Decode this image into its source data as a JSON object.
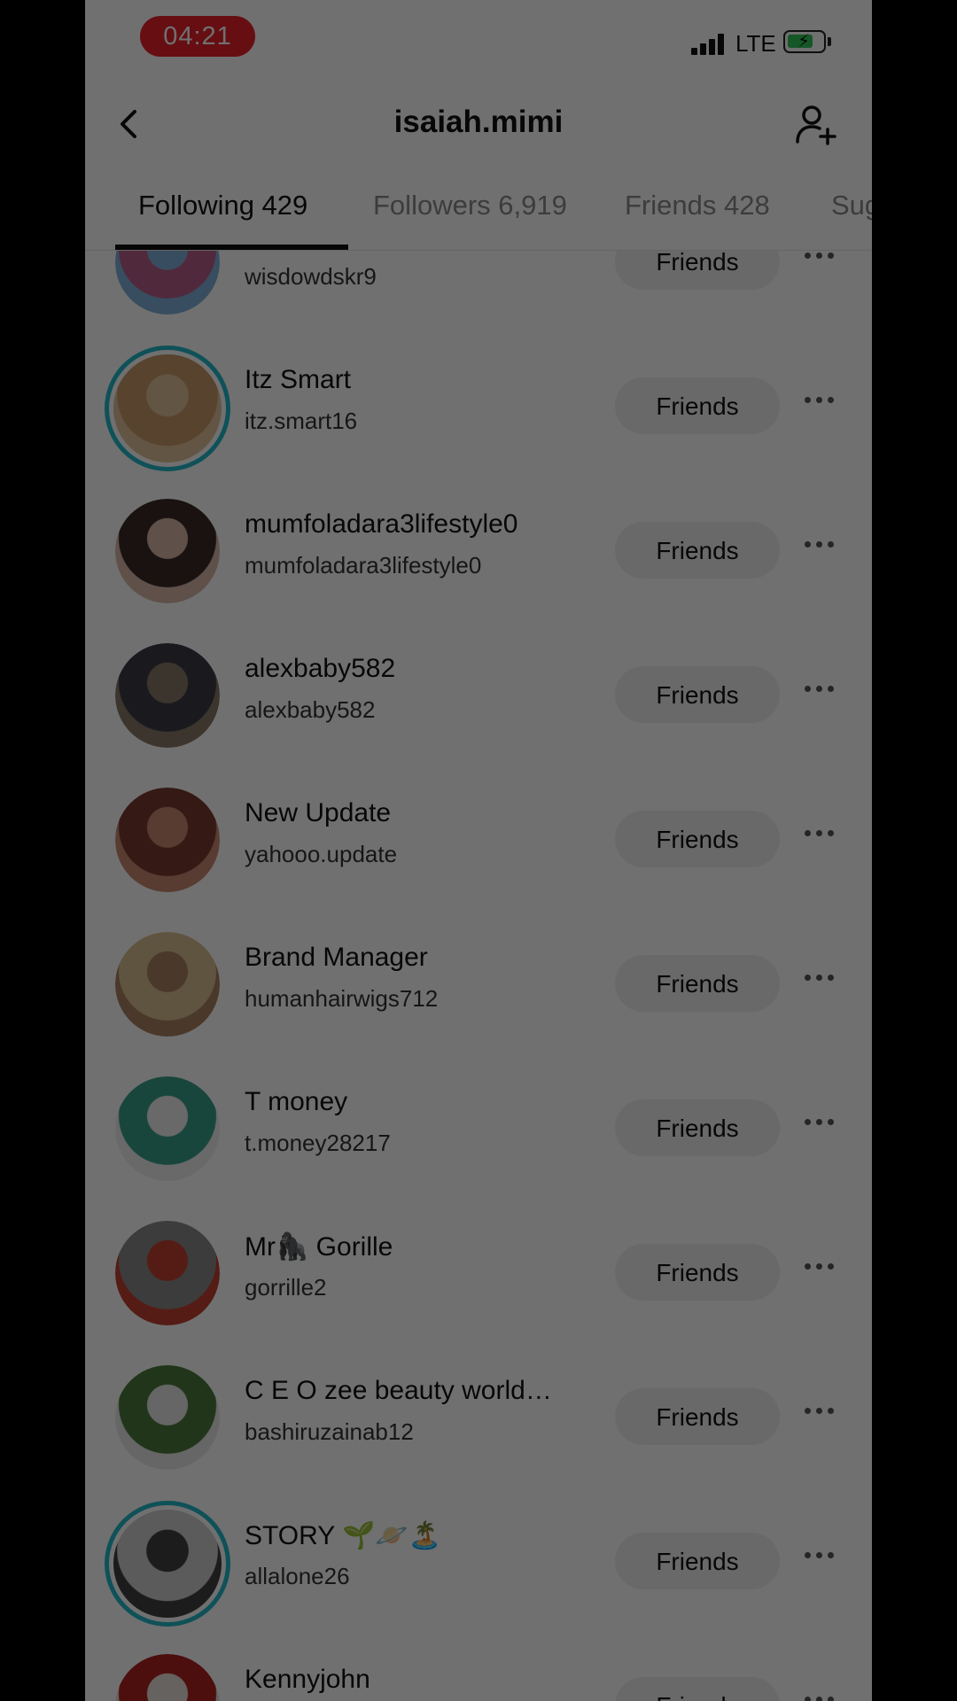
{
  "status_bar": {
    "time": "04:21",
    "network": "LTE"
  },
  "header": {
    "title": "isaiah.mimi",
    "back_icon": "chevron-left-icon",
    "add_icon": "add-user-icon"
  },
  "tabs": [
    {
      "label": "Following 429",
      "active": true
    },
    {
      "label": "Followers 6,919",
      "active": false
    },
    {
      "label": "Friends 428",
      "active": false
    },
    {
      "label": "Sug",
      "active": false
    }
  ],
  "rows": [
    {
      "name": "",
      "handle": "wisdowdskr9",
      "button": "Friends",
      "story_ring": false,
      "avatar_colors": [
        "#b85d8a",
        "#7fb0d8"
      ]
    },
    {
      "name": "Itz Smart",
      "handle": "itz.smart16",
      "button": "Friends",
      "story_ring": true,
      "avatar_colors": [
        "#c89a6a",
        "#e0c29a"
      ]
    },
    {
      "name": "mumfoladara3lifestyle0",
      "handle": "mumfoladara3lifestyle0",
      "button": "Friends",
      "story_ring": false,
      "avatar_colors": [
        "#3a2a28",
        "#d8b6a8"
      ]
    },
    {
      "name": "alexbaby582",
      "handle": "alexbaby582",
      "button": "Friends",
      "story_ring": false,
      "avatar_colors": [
        "#3c3c44",
        "#8a7a6a"
      ]
    },
    {
      "name": "New Update",
      "handle": "yahooo.update",
      "button": "Friends",
      "story_ring": false,
      "avatar_colors": [
        "#7a3a30",
        "#c88a70"
      ]
    },
    {
      "name": "Brand Manager",
      "handle": "humanhairwigs712",
      "button": "Friends",
      "story_ring": false,
      "avatar_colors": [
        "#d8c090",
        "#a88060"
      ]
    },
    {
      "name": "T money",
      "handle": "t.money28217",
      "button": "Friends",
      "story_ring": false,
      "avatar_colors": [
        "#3aa08a",
        "#f0f0f0"
      ]
    },
    {
      "name": "Mr🦍 Gorille",
      "handle": "gorrille2",
      "button": "Friends",
      "story_ring": false,
      "avatar_colors": [
        "#8a8a8a",
        "#c04030"
      ]
    },
    {
      "name": "C E O zee beauty world…",
      "handle": "bashiruzainab12",
      "button": "Friends",
      "story_ring": false,
      "avatar_colors": [
        "#4a7a3a",
        "#e8e8e8"
      ]
    },
    {
      "name": "STORY 🌱🪐🏝️",
      "handle": "allalone26",
      "button": "Friends",
      "story_ring": true,
      "avatar_colors": [
        "#d0d0d0",
        "#404040"
      ]
    },
    {
      "name": "Kennyjohn",
      "handle": "",
      "button": "Friends",
      "story_ring": false,
      "avatar_colors": [
        "#b02020",
        "#e8e0d8"
      ]
    }
  ],
  "colors": {
    "time_pill": "#e8202a",
    "story_ring": "#22b8c8",
    "battery": "#33c759"
  },
  "icons": {
    "more": "more-horizontal-icon"
  }
}
